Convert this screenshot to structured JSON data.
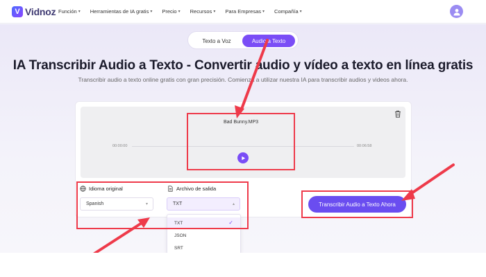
{
  "brand": {
    "name": "Vidnoz",
    "accent": "#7a4df6",
    "highlight": "#ee3a4a"
  },
  "nav": {
    "items": [
      {
        "label": "Función"
      },
      {
        "label": "Herramientas de IA gratis"
      },
      {
        "label": "Precio"
      },
      {
        "label": "Recursos"
      },
      {
        "label": "Para Empresas"
      },
      {
        "label": "Compañía"
      }
    ],
    "avatar_icon": "user-avatar-icon"
  },
  "mode_toggle": {
    "tts_label": "Texto a Voz",
    "stt_label": "Audio a Texto",
    "selected": "Audio a Texto"
  },
  "hero": {
    "title": "IA Transcribir Audio a Texto - Convertir audio y vídeo a texto en línea gratis",
    "subtitle": "Transcribir audio a texto online gratis con gran precisión. Comienza a utilizar nuestra IA para transcribir audios y videos ahora."
  },
  "player": {
    "filename": "Bad Bunny.MP3",
    "time_start": "00:00:00",
    "time_end": "00:06:58",
    "progress": 0
  },
  "options": {
    "language_label": "Idioma original",
    "language_value": "Spanish",
    "output_label": "Archivo de salida",
    "output_value": "TXT",
    "output_options": [
      "TXT",
      "JSON",
      "SRT"
    ],
    "output_selected_index": 0
  },
  "cta": {
    "label": "Transcribir Audio a Texto Ahora"
  }
}
